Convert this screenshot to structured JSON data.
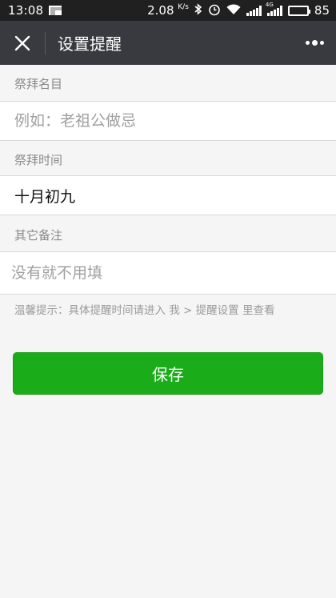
{
  "status_bar": {
    "time": "13:08",
    "speed_value": "2.08",
    "speed_unit": "K/s",
    "network_label": "4G",
    "battery": "85"
  },
  "navbar": {
    "title": "设置提醒"
  },
  "form": {
    "name": {
      "label": "祭拜名目",
      "value": "",
      "placeholder": "例如：老祖公做忌"
    },
    "time": {
      "label": "祭拜时间",
      "value": "十月初九",
      "placeholder": ""
    },
    "note": {
      "label": "其它备注",
      "value": "",
      "placeholder": "没有就不用填"
    }
  },
  "tip": "温馨提示：具体提醒时间请进入 我 > 提醒设置 里查看",
  "save_button": "保存",
  "colors": {
    "navbar_bg": "#393a3f",
    "status_bg": "#202020",
    "primary_green": "#1aad19",
    "page_bg": "#f5f5f5"
  }
}
